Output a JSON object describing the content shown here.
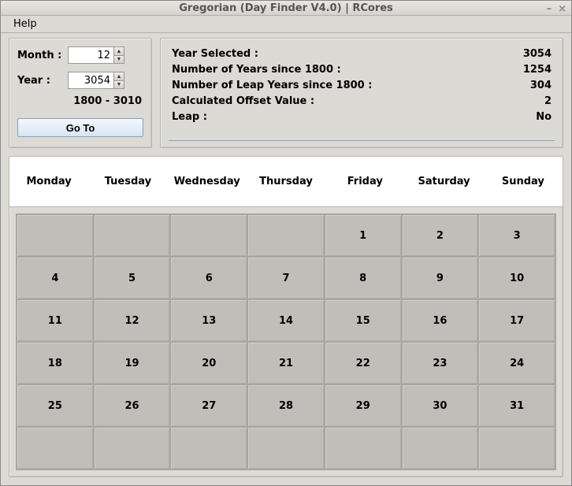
{
  "window": {
    "title": "Gregorian (Day Finder V4.0) | RCores"
  },
  "menubar": {
    "help": "Help"
  },
  "form": {
    "month_label": "Month :",
    "month_value": "12",
    "year_label": "Year :",
    "year_value": "3054",
    "year_range": "1800 - 3010",
    "goto_label": "Go To"
  },
  "info": {
    "year_selected_label": "Year Selected :",
    "year_selected_value": "3054",
    "years_since_label": "Number of Years since 1800 :",
    "years_since_value": "1254",
    "leap_since_label": "Number of Leap Years since 1800 :",
    "leap_since_value": "304",
    "offset_label": "Calculated Offset Value :",
    "offset_value": "2",
    "leap_label": "Leap :",
    "leap_value": "No"
  },
  "calendar": {
    "headers": [
      "Monday",
      "Tuesday",
      "Wednesday",
      "Thursday",
      "Friday",
      "Saturday",
      "Sunday"
    ],
    "rows": [
      [
        "",
        "",
        "",
        "",
        "1",
        "2",
        "3"
      ],
      [
        "4",
        "5",
        "6",
        "7",
        "8",
        "9",
        "10"
      ],
      [
        "11",
        "12",
        "13",
        "14",
        "15",
        "16",
        "17"
      ],
      [
        "18",
        "19",
        "20",
        "21",
        "22",
        "23",
        "24"
      ],
      [
        "25",
        "26",
        "27",
        "28",
        "29",
        "30",
        "31"
      ],
      [
        "",
        "",
        "",
        "",
        "",
        "",
        ""
      ]
    ]
  }
}
